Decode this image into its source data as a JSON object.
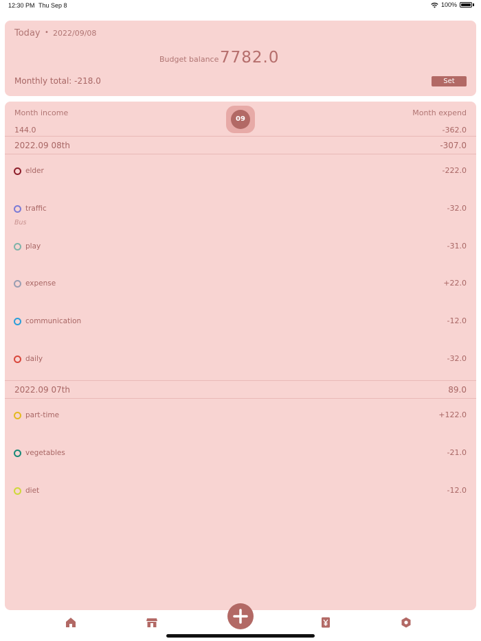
{
  "status_bar": {
    "time": "12:30 PM",
    "date": "Thu Sep 8",
    "battery": "100%"
  },
  "header": {
    "today_label": "Today",
    "separator": "•",
    "date": "2022/09/08",
    "budget_label": "Budget balance",
    "budget_value": "7782.0",
    "monthly_total": "Monthly total: -218.0",
    "set_label": "Set"
  },
  "summary": {
    "income_label": "Month income",
    "expend_label": "Month expend",
    "income_value": "144.0",
    "expend_value": "-362.0",
    "month_badge": "09"
  },
  "days": [
    {
      "date": "2022.09 08th",
      "total": "-307.0",
      "entries": [
        {
          "category": "elder",
          "note": "",
          "amount": "-222.0",
          "color": "#8e1f2b"
        },
        {
          "category": "traffic",
          "note": "Bus",
          "amount": "-32.0",
          "color": "#7b7bd6"
        },
        {
          "category": "play",
          "note": "",
          "amount": "-31.0",
          "color": "#7fb3a9"
        },
        {
          "category": "expense",
          "note": "",
          "amount": "+22.0",
          "color": "#9a9eb2"
        },
        {
          "category": "communication",
          "note": "",
          "amount": "-12.0",
          "color": "#2d9fd9"
        },
        {
          "category": "daily",
          "note": "",
          "amount": "-32.0",
          "color": "#d9483d"
        }
      ]
    },
    {
      "date": "2022.09 07th",
      "total": "89.0",
      "entries": [
        {
          "category": "part-time",
          "note": "",
          "amount": "+122.0",
          "color": "#e3b922"
        },
        {
          "category": "vegetables",
          "note": "",
          "amount": "-21.0",
          "color": "#1a8a78"
        },
        {
          "category": "diet",
          "note": "",
          "amount": "-12.0",
          "color": "#cfd83a"
        }
      ]
    }
  ],
  "nav": {
    "items": [
      "home-icon",
      "shop-icon",
      "add-icon",
      "yen-icon",
      "settings-icon"
    ],
    "accent": "#b26965"
  }
}
